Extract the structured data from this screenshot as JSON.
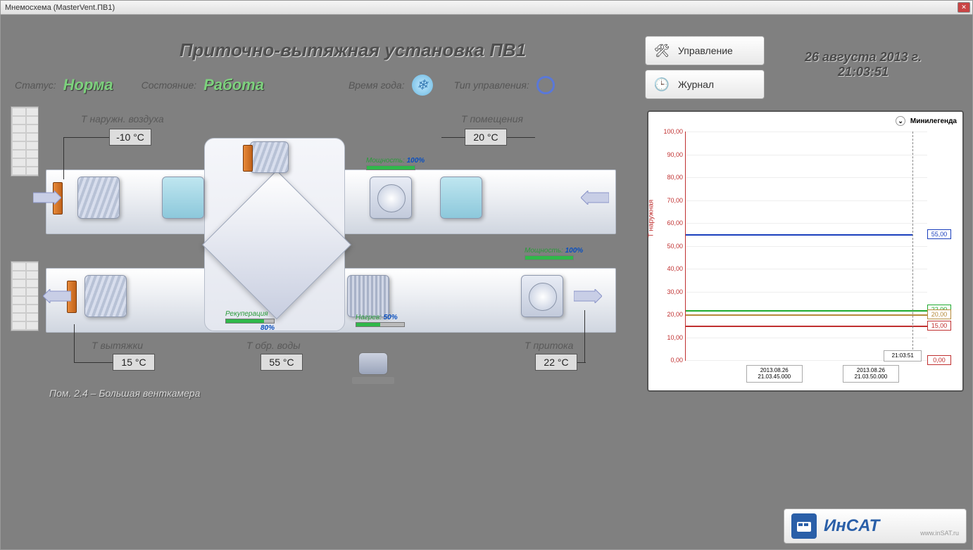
{
  "window": {
    "title": "Мнемосхема (MasterVent.ПВ1)"
  },
  "header": {
    "title": "Приточно-вытяжная установка ПВ1",
    "status_label": "Статус:",
    "status_value": "Норма",
    "state_label": "Состояние:",
    "state_value": "Работа",
    "season_label": "Время года:",
    "control_label": "Тип управления:"
  },
  "buttons": {
    "manage": "Управление",
    "journal": "Журнал"
  },
  "datetime": {
    "date": "26 августа 2013 г.",
    "time": "21:03:51"
  },
  "sensors": {
    "outdoor_label": "Т наружн. воздуха",
    "outdoor_value": "-10 °C",
    "room_label": "Т помещения",
    "room_value": "20 °C",
    "exhaust_label": "Т вытяжки",
    "exhaust_value": "15 °C",
    "return_water_label": "Т обр. воды",
    "return_water_value": "55 °C",
    "supply_label": "Т притока",
    "supply_value": "22 °C"
  },
  "progress": {
    "power1_label": "Мощность:",
    "power1_value": "100%",
    "power2_label": "Мощность:",
    "power2_value": "100%",
    "recup_label": "Рекуперация",
    "recup_value": "80%",
    "heat_label": "Нагрев:",
    "heat_value": "50%"
  },
  "room_caption": "Пом. 2.4 – Большая венткамера",
  "chart": {
    "legend_header": "Минилегенда",
    "y_axis_title": "Т наружная"
  },
  "chart_data": {
    "type": "line",
    "ylim": [
      0,
      100
    ],
    "y_ticks": [
      "0,00",
      "10,00",
      "20,00",
      "30,00",
      "40,00",
      "50,00",
      "60,00",
      "70,00",
      "80,00",
      "90,00",
      "100,00"
    ],
    "x_ticks": [
      {
        "l1": "2013.08.26",
        "l2": "21.03.45.000"
      },
      {
        "l1": "2013.08.26",
        "l2": "21.03.50.000"
      }
    ],
    "time_cursor_label": "21:03:51",
    "series": [
      {
        "name": "blue",
        "value": 55,
        "label": "55,00",
        "color": "#1a3fbd"
      },
      {
        "name": "green",
        "value": 22,
        "label": "22,00",
        "color": "#1faa2e"
      },
      {
        "name": "tan",
        "value": 20,
        "label": "20,00",
        "color": "#b58a3a"
      },
      {
        "name": "red",
        "value": 15,
        "label": "15,00",
        "color": "#c03030"
      },
      {
        "name": "baseline",
        "value": 0,
        "label": "0,00",
        "color": "#c03030"
      }
    ]
  },
  "logo": {
    "brand": "ИнCAT",
    "url": "www.inSAT.ru"
  }
}
